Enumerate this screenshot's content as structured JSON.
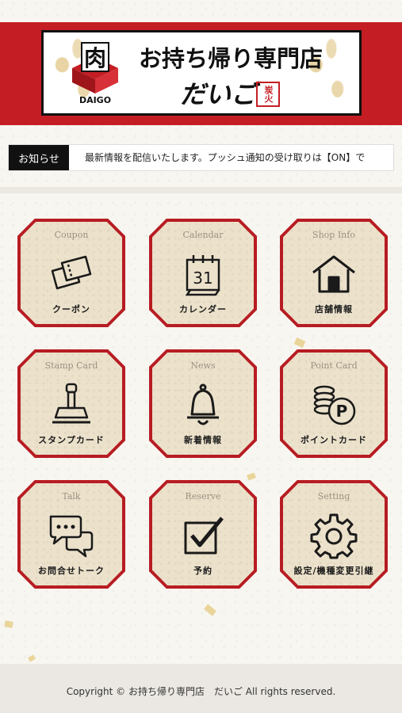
{
  "header": {
    "title": "お持ち帰り専門店",
    "subtitle": "だいご",
    "logo_brand": "DAIGO",
    "logo_kanji": "肉",
    "seal_text": "炭火"
  },
  "news": {
    "label": "お知らせ",
    "text": "最新情報を配信いたします。プッシュ通知の受け取りは【ON】で"
  },
  "menu": [
    {
      "en": "Coupon",
      "label": "クーポン",
      "icon": "coupon-icon"
    },
    {
      "en": "Calendar",
      "label": "カレンダー",
      "icon": "calendar-icon",
      "calendar_day": "31"
    },
    {
      "en": "Shop Info",
      "label": "店舗情報",
      "icon": "shop-icon"
    },
    {
      "en": "Stamp Card",
      "label": "スタンプカード",
      "icon": "stamp-icon"
    },
    {
      "en": "News",
      "label": "新着情報",
      "icon": "bell-icon"
    },
    {
      "en": "Point Card",
      "label": "ポイントカード",
      "icon": "coins-icon",
      "badge": "P"
    },
    {
      "en": "Talk",
      "label": "お問合せトーク",
      "icon": "chat-icon"
    },
    {
      "en": "Reserve",
      "label": "予約",
      "icon": "check-icon"
    },
    {
      "en": "Setting",
      "label": "設定/機種変更引継",
      "icon": "gear-icon"
    }
  ],
  "footer": {
    "copyright": "Copyright © お持ち帰り専門店　だいご All rights reserved."
  },
  "colors": {
    "brand_red": "#c41e24",
    "tile_bg": "#ece2cc",
    "news_label_bg": "#111111"
  }
}
